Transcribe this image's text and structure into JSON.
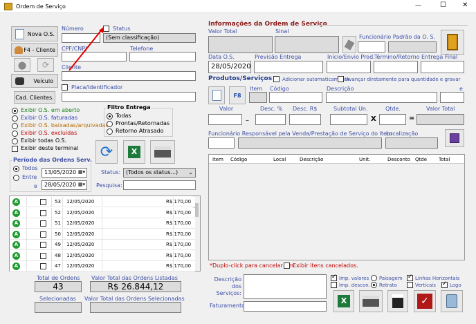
{
  "window": {
    "title": "Ordem de Serviço",
    "min": "—",
    "max": "☐",
    "close": "✕"
  },
  "left": {
    "btn_nova": "Nova O.S.",
    "btn_cliente": "F4 - Cliente",
    "btn_veiculo": "Veículo",
    "btn_cad": "Cad. Clientes.",
    "numero_label": "Número",
    "status_label": "Status",
    "status_value": "(Sem classificação)",
    "cpf_label": "CPF/CNPJ",
    "telefone_label": "Telefone",
    "cliente_label": "Cliente",
    "placa_label": "Placa/Identificador",
    "filters": [
      {
        "label": "Exibir O.S. em aberto",
        "color": "#1a7f1a",
        "on": true
      },
      {
        "label": "Exibir O.S. faturadas",
        "color": "#2a3fb5",
        "on": false
      },
      {
        "label": "Exibir O.S. baixadas/arquivadas",
        "color": "#b86b00",
        "on": false
      },
      {
        "label": "Exibir O.S. excluídas",
        "color": "#c00000",
        "on": false
      },
      {
        "label": "Exibir todas O.S.",
        "color": "#000000",
        "on": false
      }
    ],
    "exibir_terminal": "Exibir deste terminal",
    "filtro_entrega": "Filtro Entrega",
    "fe_todas": "Todas",
    "fe_prontas": "Prontas/Retornadas",
    "fe_retorno": "Retorno Atrasado",
    "periodo": "Período das Ordens Serv.",
    "todos": "Todos",
    "entre": "Entre",
    "e": "e",
    "date1": "13/05/2020",
    "date2": "28/05/2020",
    "status2_label": "Status:",
    "status2_value": "(Todos os status...)",
    "pesquisa_label": "Pesquisa:",
    "rows": [
      {
        "n": "53",
        "d": "12/05/2020",
        "v": "R$ 170,00"
      },
      {
        "n": "52",
        "d": "12/05/2020",
        "v": "R$ 170,00"
      },
      {
        "n": "51",
        "d": "12/05/2020",
        "v": "R$ 170,00"
      },
      {
        "n": "50",
        "d": "12/05/2020",
        "v": "R$ 170,00"
      },
      {
        "n": "49",
        "d": "12/05/2020",
        "v": "R$ 170,00"
      },
      {
        "n": "48",
        "d": "12/05/2020",
        "v": "R$ 170,00"
      },
      {
        "n": "47",
        "d": "12/05/2020",
        "v": "R$ 170,00"
      }
    ],
    "total_ordens_label": "Total de Ordens",
    "total_ordens": "43",
    "valor_total_label": "Valor Total das Ordens Listadas",
    "valor_total": "R$ 26.844,12",
    "selecionadas_label": "Selecionadas",
    "valor_sel_label": "Valor Total das Ordens Selecionadas"
  },
  "right": {
    "info_title": "Informações da Ordem de Serviço",
    "valor_total": "Valor Total",
    "sinal": "Sinal",
    "func_padrao": "Funcionário Padrão da O. S.",
    "data_os": "Data O.S.",
    "data_os_value": "28/05/2020",
    "previsao": "Previsão Entrega",
    "inicio": "Início/Envio Prod.",
    "termino": "Término/Retorno",
    "entrega_final": "Entrega Final",
    "prod_title": "Produtos/Serviços",
    "add_auto": "Adicionar automaticamente",
    "avancar": "Avançar diretamente para quantidade e gravar",
    "item": "Item",
    "codigo": "Código",
    "descricao": "Descrição",
    "e": "e",
    "valor": "Valor",
    "desc_pct": "Desc. %",
    "desc_rs": "Desc. R$",
    "subtotal": "Subtotal Un.",
    "qtde": "Qtde.",
    "valor_total2": "Valor Total",
    "dash": "–",
    "x": "X",
    "eq": "=",
    "func_resp": "Funcionário Responsável pela Venda/Prestação de Serviço do Item",
    "localizacao": "Localização",
    "cols": [
      "Item",
      "Código",
      "Local",
      "Descrição",
      "Unit.",
      "Desconto",
      "Qtde",
      "Total"
    ],
    "dblclick": "*Duplo-click para cancelar um",
    "exibir_cancel": "Exibir itens cancelados.",
    "desc_servicos": "Descrição dos Serviços:",
    "faturamento": "Faturamento:",
    "imp_valores": "Imp. valores",
    "paisagem": "Paisagem",
    "linhas_h": "Linhas Horizontais",
    "imp_descon": "Imp. descon.",
    "retrato": "Retrato",
    "verticais": "Verticais",
    "logo": "Logo"
  }
}
